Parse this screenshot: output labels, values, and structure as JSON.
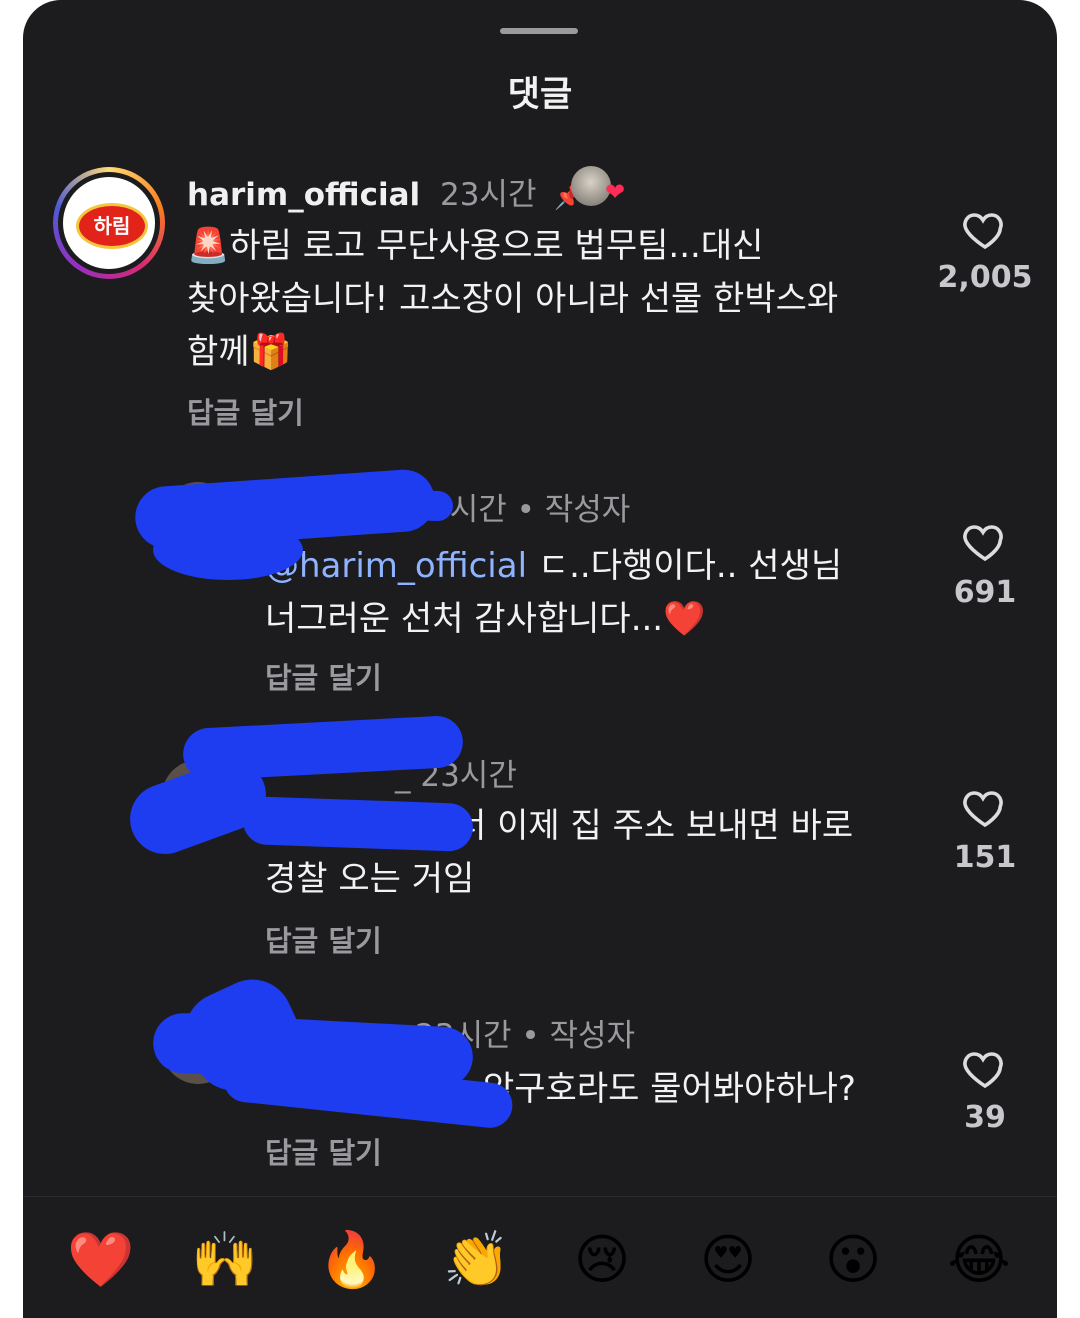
{
  "sheet": {
    "title": "댓글"
  },
  "comments": [
    {
      "username": "harim_official",
      "time": "23시간",
      "pin_icon": "pin-icon",
      "text_line1": "🚨하림 로고 무단사용으로 법무팀...대신",
      "text_line2": "찾아왔습니다! 고소장이 아니라 선물 한박스와",
      "text_line3": "함께🎁",
      "reply_label": "답글 달기",
      "like_count": "2,005",
      "avatar_badge_text": "하림"
    },
    {
      "username_visible_fragment": "3시간 • 작성자",
      "mention": "@harim_official",
      "text_line1_rest": " ㄷ..다행이다.. 선생님",
      "text_line2": "너그러운 선처 감사합니다...❤️",
      "reply_label": "답글 달기",
      "like_count": "691"
    },
    {
      "time": "_ 23시간",
      "text_line1": "너 이제 집 주소 보내면 바로",
      "text_line2": "경찰 오는 거임",
      "reply_label": "답글 달기",
      "like_count": "151"
    },
    {
      "time": "23시간 • 작성자",
      "text_line1": "암구호라도 물어봐야하나?",
      "reply_label": "답글 달기",
      "like_count": "39"
    }
  ],
  "emoji_bar": [
    "❤️",
    "🙌",
    "🔥",
    "👏",
    "😢",
    "😍",
    "😮",
    "😂"
  ],
  "colors": {
    "background": "#1c1c1f",
    "redaction": "#1f3df0",
    "mention": "#8fb3ff"
  }
}
